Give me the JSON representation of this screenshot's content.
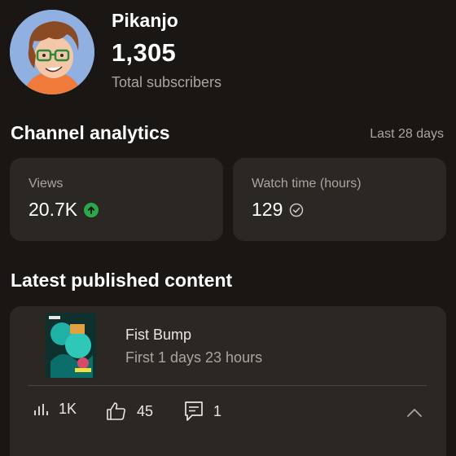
{
  "channel": {
    "name": "Pikanjo",
    "subscribers": "1,305",
    "subscribers_label": "Total subscribers"
  },
  "analytics": {
    "title": "Channel analytics",
    "period": "Last 28 days",
    "cards": [
      {
        "label": "Views",
        "value": "20.7K",
        "indicator": "up-arrow-icon"
      },
      {
        "label": "Watch time (hours)",
        "value": "129",
        "indicator": "check-icon"
      }
    ]
  },
  "latest": {
    "title": "Latest published content",
    "video": {
      "title": "Fist Bump",
      "subtitle": "First 1 days 23 hours",
      "stats": {
        "views": "1K",
        "likes": "45",
        "comments": "1"
      }
    }
  },
  "colors": {
    "background": "#1a1613",
    "card": "#2b2723",
    "muted_text": "#aaa59f",
    "positive": "#2ba84a"
  }
}
